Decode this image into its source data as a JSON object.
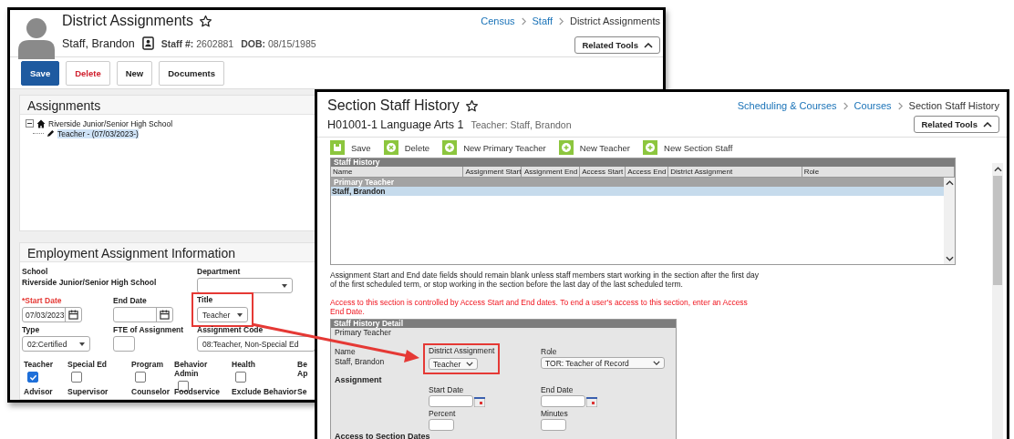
{
  "back_window": {
    "title": "District Assignments",
    "breadcrumb": [
      {
        "label": "Census",
        "link": true
      },
      {
        "label": "Staff",
        "link": true
      },
      {
        "label": "District Assignments",
        "link": false
      }
    ],
    "staff_name": "Staff, Brandon",
    "staff_number_label": "Staff #:",
    "staff_number": "2602881",
    "dob_label": "DOB:",
    "dob": "08/15/1985",
    "related_tools": "Related Tools",
    "buttons": [
      {
        "label": "Save",
        "kind": "primary"
      },
      {
        "label": "Delete",
        "kind": "danger"
      },
      {
        "label": "New",
        "kind": "default"
      },
      {
        "label": "Documents",
        "kind": "default"
      }
    ],
    "assignments": {
      "title": "Assignments",
      "tree": [
        {
          "label": "Riverside Junior/Senior High School",
          "expanded": true,
          "children": [
            {
              "label": "Teacher - (07/03/2023-)",
              "selected": true
            }
          ]
        }
      ]
    },
    "employment": {
      "title": "Employment Assignment Information",
      "school_label": "School",
      "school": "Riverside Junior/Senior High School",
      "department_label": "Department",
      "start_date": {
        "label": "*Start Date",
        "required": true,
        "value": "07/03/2023"
      },
      "end_date": {
        "label": "End Date",
        "required": false
      },
      "title_field": {
        "label": "Title",
        "value": "Teacher",
        "highlighted": true
      },
      "type": {
        "label": "Type",
        "value": "02:Certified"
      },
      "fte": {
        "label": "FTE of Assignment"
      },
      "assignment_code": {
        "label": "Assignment Code",
        "value": "08:Teacher, Non-Special Ed"
      },
      "flags": [
        {
          "label": "Teacher",
          "checked": true
        },
        {
          "label": "Special Ed",
          "checked": false
        },
        {
          "label": "Program",
          "checked": false
        },
        {
          "label": "Behavior Admin",
          "checked": false
        },
        {
          "label": "Health",
          "checked": false
        },
        {
          "label": "Be Ap"
        }
      ],
      "flags_row_2": [
        "Advisor",
        "Supervisor",
        "Counselor",
        "Foodservice",
        "Exclude Behavior",
        "Se"
      ]
    }
  },
  "front_window": {
    "title": "Section Staff History",
    "breadcrumb": [
      {
        "label": "Scheduling & Courses",
        "link": true
      },
      {
        "label": "Courses",
        "link": true
      },
      {
        "label": "Section Staff History",
        "link": false
      }
    ],
    "section": "H01001-1 Language Arts 1",
    "teacher": "Teacher: Staff, Brandon",
    "related_tools": "Related Tools",
    "toolbar": [
      {
        "label": "Save",
        "kind": "save"
      },
      {
        "label": "Delete",
        "kind": "delete"
      },
      {
        "label": "New Primary Teacher",
        "kind": "add"
      },
      {
        "label": "New Teacher",
        "kind": "add"
      },
      {
        "label": "New Section Staff",
        "kind": "add"
      }
    ],
    "staff_history": {
      "title": "Staff History",
      "columns": [
        "Name",
        "Assignment Start",
        "Assignment End",
        "Access Start",
        "Access End",
        "District Assignment",
        "Role"
      ],
      "groups": [
        {
          "label": "Primary Teacher",
          "rows": [
            {
              "name": "Staff, Brandon",
              "selected": true
            }
          ]
        }
      ]
    },
    "notes": [
      {
        "kind": "info",
        "text": "Assignment Start and End date fields should remain blank unless staff members start working in the section after the first day of the first scheduled term, or stop working in the section before the last day of the last scheduled term."
      },
      {
        "kind": "warning",
        "text": "Access to this section is controlled by Access Start and End dates. To end a user's access to this section, enter an Access End Date."
      }
    ],
    "detail": {
      "title": "Staff History Detail",
      "group": "Primary Teacher",
      "name_label": "Name",
      "name": "Staff, Brandon",
      "district_assignment": {
        "label": "District Assignment",
        "value": "Teacher",
        "highlighted": true
      },
      "role": {
        "label": "Role",
        "value": "TOR: Teacher of Record"
      },
      "assignment_heading": "Assignment",
      "start_date": "Start Date",
      "end_date": "End Date",
      "percent": "Percent",
      "minutes": "Minutes",
      "access_heading": "Access to Section Dates"
    }
  }
}
